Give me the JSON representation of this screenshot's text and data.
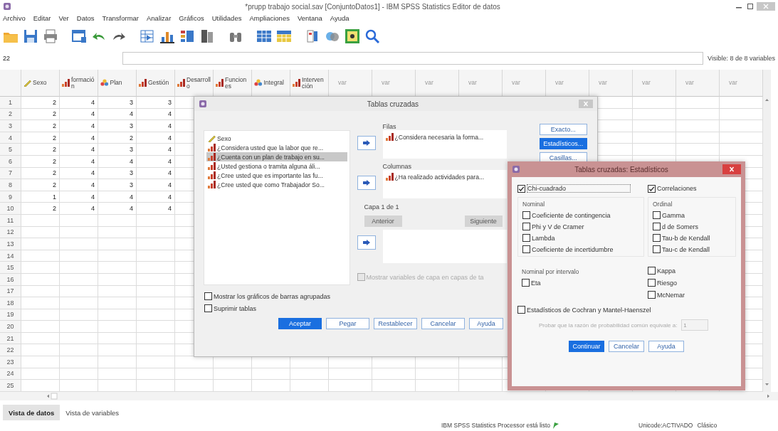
{
  "window": {
    "title": "*prupp trabajo social.sav [ConjuntoDatos1] - IBM SPSS Statistics Editor de datos"
  },
  "menu": [
    "Archivo",
    "Editar",
    "Ver",
    "Datos",
    "Transformar",
    "Analizar",
    "Gráficos",
    "Utilidades",
    "Ampliaciones",
    "Ventana",
    "Ayuda"
  ],
  "cell_bar": {
    "cell": "22",
    "visible": "Visible: 8 de 8 variables"
  },
  "grid": {
    "columns": [
      {
        "name": "Sexo",
        "kind": "scale"
      },
      {
        "name": "formación",
        "kind": "ordinal"
      },
      {
        "name": "Plan",
        "kind": "nominal"
      },
      {
        "name": "Gestión",
        "kind": "ordinal"
      },
      {
        "name": "Desarrollo",
        "kind": "ordinal"
      },
      {
        "name": "Funciones",
        "kind": "ordinal"
      },
      {
        "name": "Integral",
        "kind": "nominal"
      },
      {
        "name": "Intervención",
        "kind": "ordinal"
      },
      {
        "name": "var",
        "kind": "none"
      },
      {
        "name": "var",
        "kind": "none"
      },
      {
        "name": "var",
        "kind": "none"
      },
      {
        "name": "var",
        "kind": "none"
      },
      {
        "name": "var",
        "kind": "none"
      },
      {
        "name": "var",
        "kind": "none"
      },
      {
        "name": "var",
        "kind": "none"
      },
      {
        "name": "var",
        "kind": "none"
      },
      {
        "name": "var",
        "kind": "none"
      },
      {
        "name": "var",
        "kind": "none"
      }
    ],
    "rows": [
      {
        "number": "1",
        "cells": [
          "2",
          "4",
          "3",
          "3"
        ]
      },
      {
        "number": "2",
        "cells": [
          "2",
          "4",
          "4",
          "4"
        ]
      },
      {
        "number": "3",
        "cells": [
          "2",
          "4",
          "3",
          "4"
        ]
      },
      {
        "number": "4",
        "cells": [
          "2",
          "4",
          "2",
          "4"
        ]
      },
      {
        "number": "5",
        "cells": [
          "2",
          "4",
          "3",
          "4"
        ]
      },
      {
        "number": "6",
        "cells": [
          "2",
          "4",
          "4",
          "4"
        ]
      },
      {
        "number": "7",
        "cells": [
          "2",
          "4",
          "3",
          "4"
        ]
      },
      {
        "number": "8",
        "cells": [
          "2",
          "4",
          "3",
          "4"
        ]
      },
      {
        "number": "9",
        "cells": [
          "1",
          "4",
          "4",
          "4"
        ]
      },
      {
        "number": "10",
        "cells": [
          "2",
          "4",
          "4",
          "4"
        ]
      },
      {
        "number": "11",
        "cells": []
      },
      {
        "number": "12",
        "cells": []
      },
      {
        "number": "13",
        "cells": []
      },
      {
        "number": "14",
        "cells": []
      },
      {
        "number": "15",
        "cells": []
      },
      {
        "number": "16",
        "cells": []
      },
      {
        "number": "17",
        "cells": []
      },
      {
        "number": "18",
        "cells": []
      },
      {
        "number": "19",
        "cells": []
      },
      {
        "number": "20",
        "cells": []
      },
      {
        "number": "21",
        "cells": []
      },
      {
        "number": "22",
        "cells": []
      },
      {
        "number": "23",
        "cells": []
      },
      {
        "number": "24",
        "cells": []
      },
      {
        "number": "25",
        "cells": []
      }
    ]
  },
  "crosstabs_dialog": {
    "title": "Tablas cruzadas",
    "variables": [
      {
        "label": "Sexo",
        "kind": "scale",
        "selected": false
      },
      {
        "label": "¿Considera usted que la labor que re...",
        "kind": "ordinal",
        "selected": false
      },
      {
        "label": "¿Cuenta con un plan de trabajo en su...",
        "kind": "ordinal",
        "selected": true
      },
      {
        "label": "¿Usted gestiona o tramita alguna áli...",
        "kind": "ordinal",
        "selected": false
      },
      {
        "label": "¿Cree usted que es importante las fu...",
        "kind": "ordinal",
        "selected": false
      },
      {
        "label": "¿Cree usted que como Trabajador So...",
        "kind": "ordinal",
        "selected": false
      }
    ],
    "rows_label": "Filas",
    "rows": [
      {
        "label": "¿Considera necesaria la forma...",
        "kind": "ordinal"
      }
    ],
    "columns_label": "Columnas",
    "columns": [
      {
        "label": "¿Ha realizado actividades para...",
        "kind": "ordinal"
      }
    ],
    "layer_label": "Capa 1 de 1",
    "layer_buttons": [
      {
        "label": "Anterior",
        "disabled": true
      },
      {
        "label": "Siguiente",
        "disabled": true
      }
    ],
    "side_buttons": [
      {
        "label": "Exacto...",
        "selected": false
      },
      {
        "label": "Estadísticos...",
        "selected": true
      },
      {
        "label": "Casillas...",
        "selected": false
      }
    ],
    "layer_option": {
      "label": "Mostrar variables de capa en capas de ta",
      "checked": false,
      "disabled": true
    },
    "options": [
      {
        "label": "Mostrar los gráficos de barras agrupadas",
        "checked": false
      },
      {
        "label": "Suprimir tablas",
        "checked": false
      }
    ],
    "buttons": [
      {
        "label": "Aceptar",
        "default": true
      },
      {
        "label": "Pegar",
        "default": false
      },
      {
        "label": "Restablecer",
        "default": false
      },
      {
        "label": "Cancelar",
        "default": false
      },
      {
        "label": "Ayuda",
        "default": false
      }
    ]
  },
  "statistics_dialog": {
    "title": "Tablas cruzadas: Estadísticos",
    "chi_square": {
      "label": "Chi-cuadrado",
      "checked": true
    },
    "correlations": {
      "label": "Correlaciones",
      "checked": true
    },
    "nominal": {
      "label": "Nominal",
      "items": [
        {
          "label": "Coeficiente de contingencia",
          "checked": false
        },
        {
          "label": "Phi y V de Cramer",
          "checked": false
        },
        {
          "label": "Lambda",
          "checked": false
        },
        {
          "label": "Coeficiente de incertidumbre",
          "checked": false
        }
      ]
    },
    "ordinal": {
      "label": "Ordinal",
      "items": [
        {
          "label": "Gamma",
          "checked": false
        },
        {
          "label": "d de Somers",
          "checked": false
        },
        {
          "label": "Tau-b de Kendall",
          "checked": false
        },
        {
          "label": "Tau-c de Kendall",
          "checked": false
        }
      ]
    },
    "nominal_interval": {
      "label": "Nominal por intervalo",
      "items": [
        {
          "label": "Eta",
          "checked": false
        }
      ]
    },
    "other": [
      {
        "label": "Kappa",
        "checked": false
      },
      {
        "label": "Riesgo",
        "checked": false
      },
      {
        "label": "McNemar",
        "checked": false
      }
    ],
    "cochran": {
      "label": "Estadísticos de Cochran y Mantel-Haenszel",
      "checked": false
    },
    "odds_test": {
      "label": "Probar que la razón de probabilidad común equivale a:",
      "value": "1",
      "disabled": true
    },
    "buttons": [
      {
        "label": "Continuar",
        "default": true
      },
      {
        "label": "Cancelar",
        "default": false
      },
      {
        "label": "Ayuda",
        "default": false
      }
    ]
  },
  "view_tabs": [
    {
      "label": "Vista de datos",
      "selected": true
    },
    {
      "label": "Vista de variables",
      "selected": false
    }
  ],
  "status_bar": {
    "processor": "IBM SPSS Statistics Processor está listo",
    "unicode": "Unicode:ACTIVADO",
    "mode": "Clásico"
  }
}
